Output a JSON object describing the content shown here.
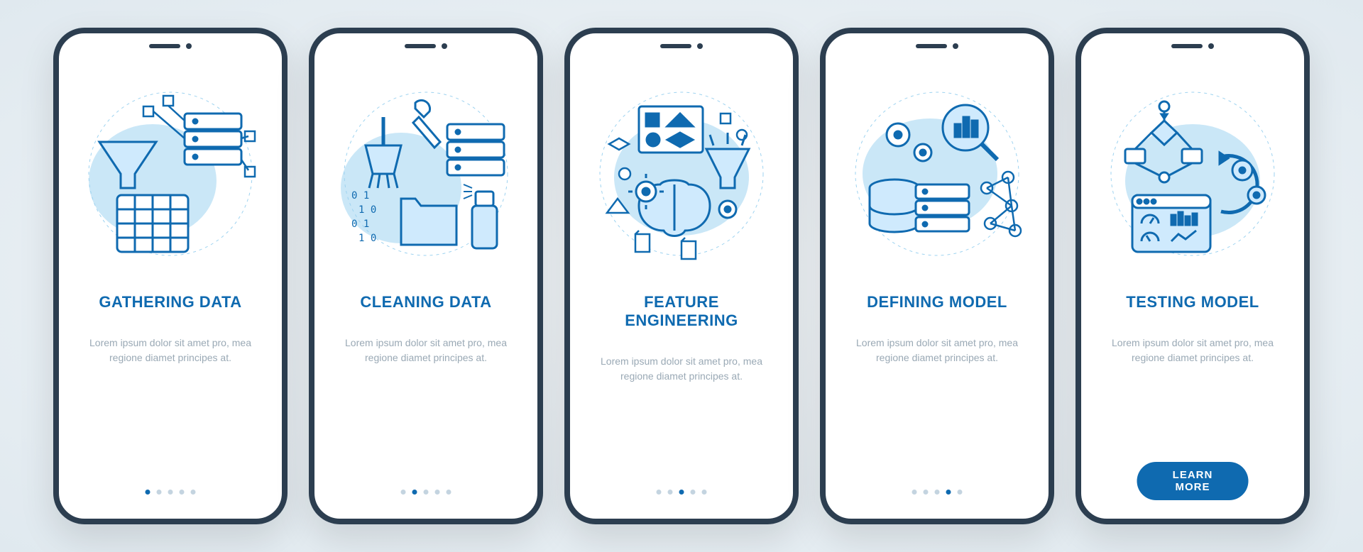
{
  "colors": {
    "accent": "#0f6ab0",
    "light": "#9ed3f0",
    "muted": "#9aa9b5",
    "frame": "#2c3e50"
  },
  "screens": [
    {
      "title": "GATHERING DATA",
      "description": "Lorem ipsum dolor sit amet pro, mea regione diamet principes at.",
      "activeDot": 0,
      "icon": "gathering-data"
    },
    {
      "title": "CLEANING DATA",
      "description": "Lorem ipsum dolor sit amet pro, mea regione diamet principes at.",
      "activeDot": 1,
      "icon": "cleaning-data"
    },
    {
      "title": "FEATURE ENGINEERING",
      "description": "Lorem ipsum dolor sit amet pro, mea regione diamet principes at.",
      "activeDot": 2,
      "icon": "feature-engineering"
    },
    {
      "title": "DEFINING MODEL",
      "description": "Lorem ipsum dolor sit amet pro, mea regione diamet principes at.",
      "activeDot": 3,
      "icon": "defining-model"
    },
    {
      "title": "TESTING MODEL",
      "description": "Lorem ipsum dolor sit amet pro, mea regione diamet principes at.",
      "activeDot": 4,
      "icon": "testing-model",
      "cta": "LEARN MORE"
    }
  ],
  "totalDots": 5
}
